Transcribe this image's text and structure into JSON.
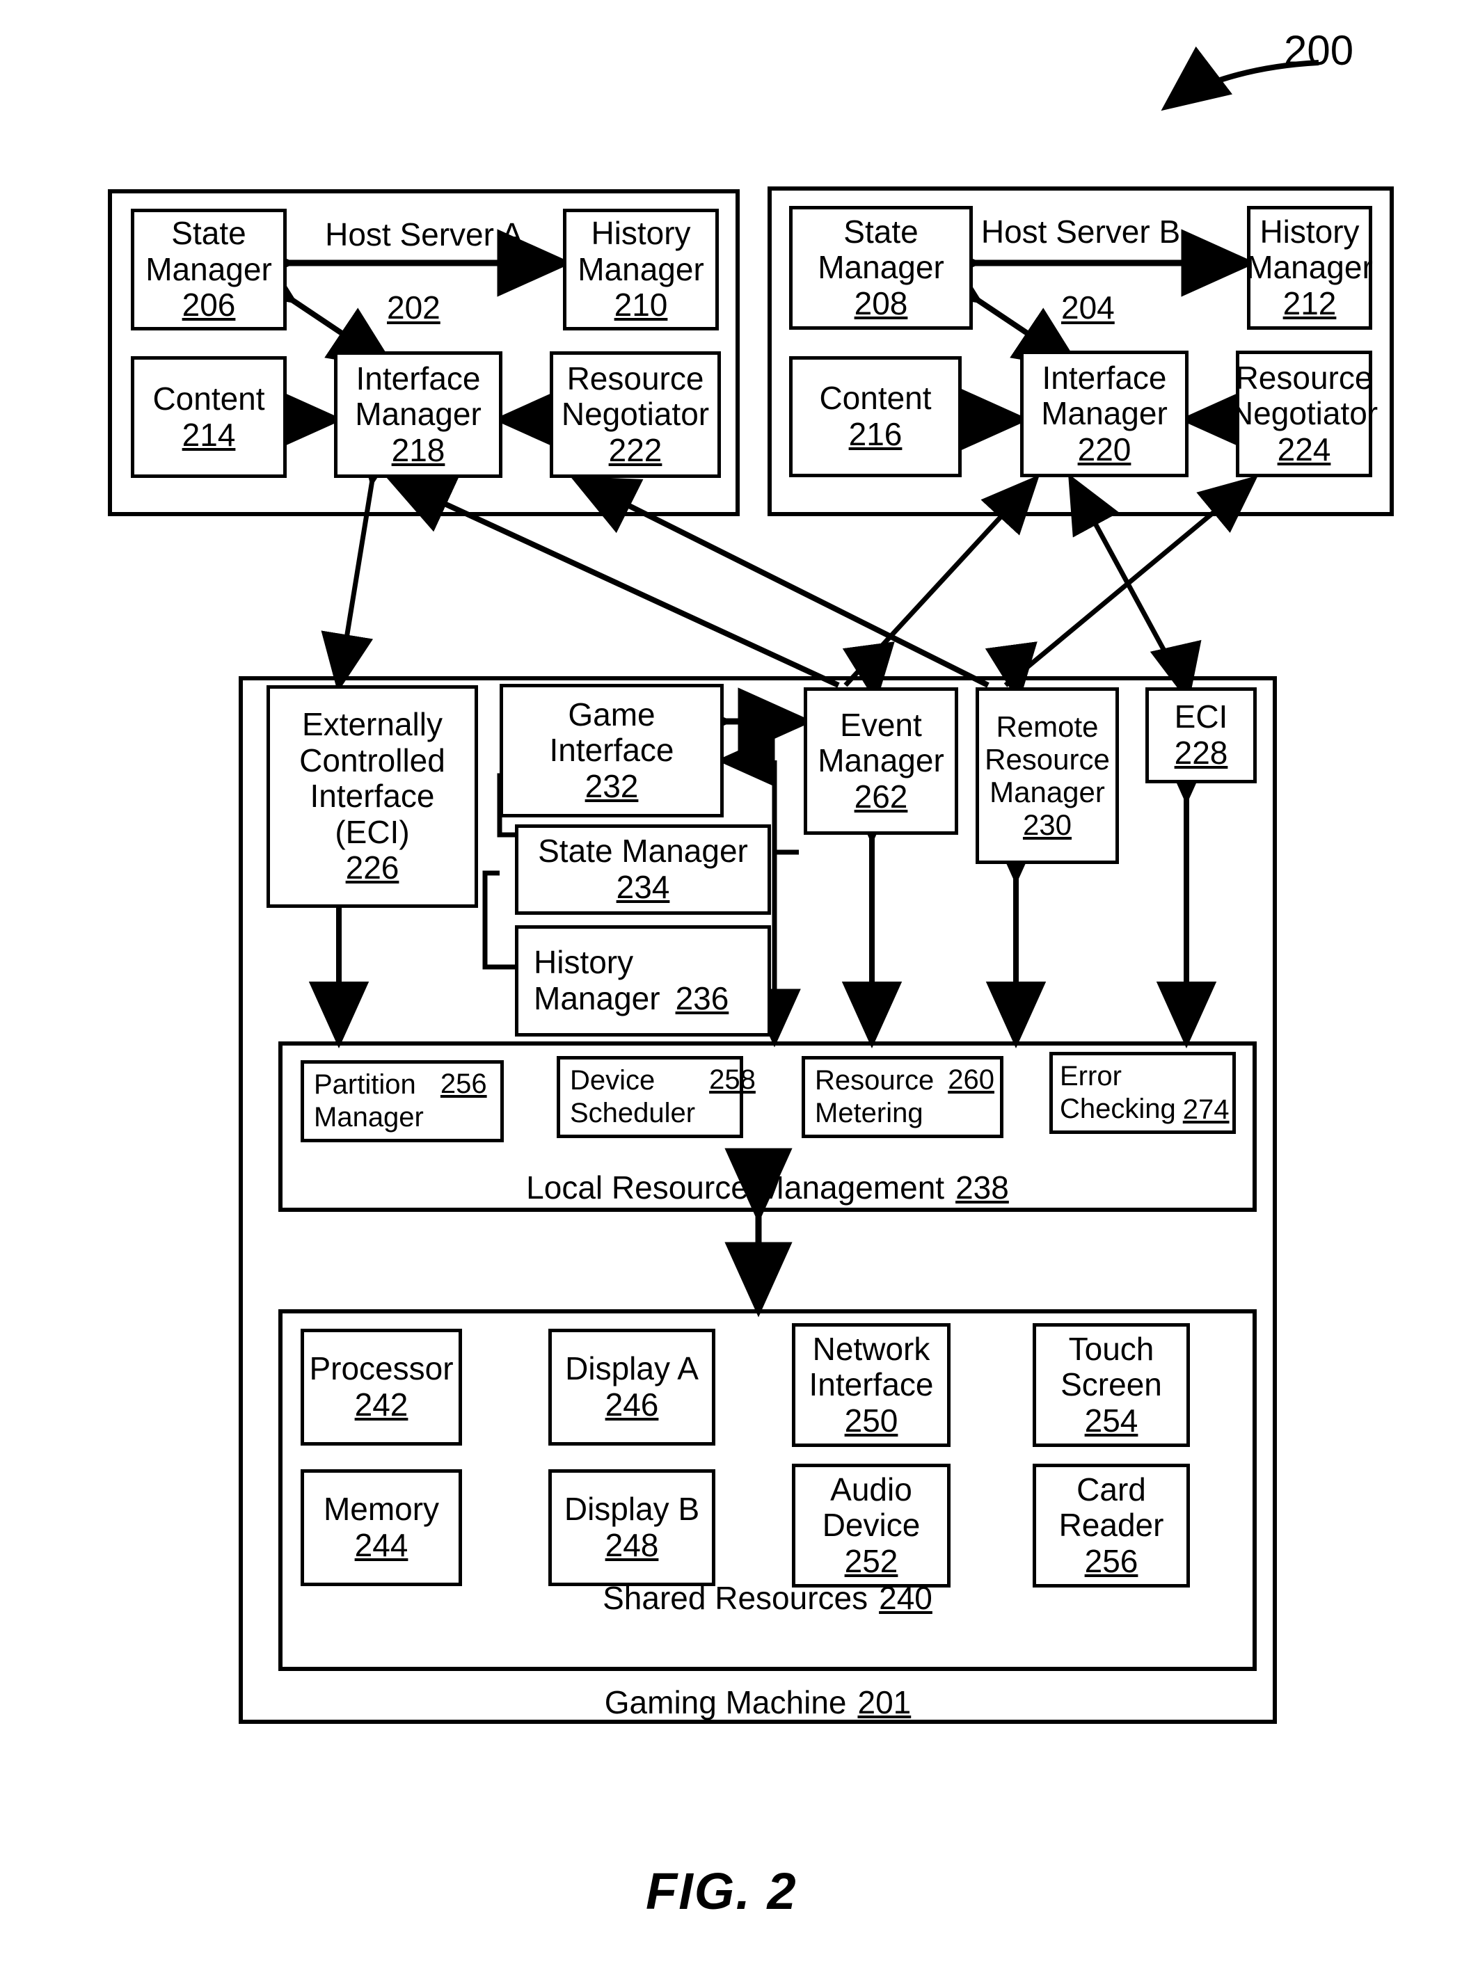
{
  "figure": {
    "caption": "FIG. 2",
    "system_ref": "200"
  },
  "host_server_a": {
    "title": "Host Server A",
    "ref": "202",
    "boxes": [
      {
        "line1": "State",
        "line2": "Manager",
        "ref": "206"
      },
      {
        "line1": "History",
        "line2": "Manager",
        "ref": "210"
      },
      {
        "line1": "Content",
        "line2": "",
        "ref": "214"
      },
      {
        "line1": "Interface",
        "line2": "Manager",
        "ref": "218"
      },
      {
        "line1": "Resource",
        "line2": "Negotiator",
        "ref": "222"
      }
    ]
  },
  "host_server_b": {
    "title": "Host Server B",
    "ref": "204",
    "boxes": [
      {
        "line1": "State",
        "line2": "Manager",
        "ref": "208"
      },
      {
        "line1": "History",
        "line2": "Manager",
        "ref": "212"
      },
      {
        "line1": "Content",
        "line2": "",
        "ref": "216"
      },
      {
        "line1": "Interface",
        "line2": "Manager",
        "ref": "220"
      },
      {
        "line1": "Resource",
        "line2": "Negotiator",
        "ref": "224"
      }
    ]
  },
  "gaming_machine": {
    "title": "Gaming Machine",
    "ref": "201",
    "eci": {
      "line1": "Externally",
      "line2": "Controlled",
      "line3": "Interface",
      "line4": "(ECI)",
      "ref": "226"
    },
    "game_interface": {
      "line1": "Game",
      "line2": "Interface",
      "ref": "232"
    },
    "state_manager": {
      "label": "State Manager",
      "ref": "234"
    },
    "history_manager": {
      "line1": "History",
      "line2": "Manager",
      "ref": "236"
    },
    "event_manager": {
      "line1": "Event",
      "line2": "Manager",
      "ref": "262"
    },
    "remote_resource_manager": {
      "line1": "Remote",
      "line2": "Resource",
      "line3": "Manager",
      "ref": "230"
    },
    "eci_small": {
      "label": "ECI",
      "ref": "228"
    },
    "local_resource_management": {
      "title": "Local Resource Management",
      "ref": "238",
      "items": [
        {
          "line1": "Partition",
          "line2": "Manager",
          "ref": "256"
        },
        {
          "line1": "Device",
          "line2": "Scheduler",
          "ref": "258"
        },
        {
          "line1": "Resource",
          "line2": "Metering",
          "ref": "260"
        },
        {
          "line1": "Error",
          "line2": "Checking",
          "ref": "274"
        }
      ]
    },
    "shared_resources": {
      "title": "Shared Resources",
      "ref": "240",
      "items": [
        {
          "line1": "Processor",
          "line2": "",
          "ref": "242"
        },
        {
          "line1": "Display A",
          "line2": "",
          "ref": "246"
        },
        {
          "line1": "Network",
          "line2": "Interface",
          "ref": "250"
        },
        {
          "line1": "Touch",
          "line2": "Screen",
          "ref": "254"
        },
        {
          "line1": "Memory",
          "line2": "",
          "ref": "244"
        },
        {
          "line1": "Display B",
          "line2": "",
          "ref": "248"
        },
        {
          "line1": "Audio",
          "line2": "Device",
          "ref": "252"
        },
        {
          "line1": "Card",
          "line2": "Reader",
          "ref": "256"
        }
      ]
    }
  }
}
